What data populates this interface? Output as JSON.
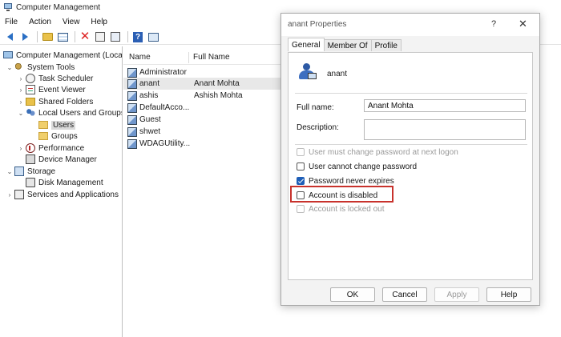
{
  "window": {
    "title": "Computer Management"
  },
  "menu": [
    "File",
    "Action",
    "View",
    "Help"
  ],
  "tree": [
    {
      "label": "Computer Management (Local",
      "caret": "",
      "icon": "computer-icon"
    },
    {
      "label": "System Tools",
      "caret": "v",
      "icon": "tools-icon"
    },
    {
      "label": "Task Scheduler",
      "caret": ">",
      "icon": "clock-icon"
    },
    {
      "label": "Event Viewer",
      "caret": ">",
      "icon": "event-viewer-icon"
    },
    {
      "label": "Shared Folders",
      "caret": ">",
      "icon": "shared-folder-icon"
    },
    {
      "label": "Local Users and Groups",
      "caret": "v",
      "icon": "users-icon"
    },
    {
      "label": "Users",
      "caret": "",
      "icon": "folder-icon",
      "selected": true
    },
    {
      "label": "Groups",
      "caret": "",
      "icon": "folder-icon"
    },
    {
      "label": "Performance",
      "caret": ">",
      "icon": "performance-icon"
    },
    {
      "label": "Device Manager",
      "caret": "",
      "icon": "device-icon"
    },
    {
      "label": "Storage",
      "caret": "v",
      "icon": "storage-icon"
    },
    {
      "label": "Disk Management",
      "caret": "",
      "icon": "disk-icon"
    },
    {
      "label": "Services and Applications",
      "caret": ">",
      "icon": "services-icon"
    }
  ],
  "list": {
    "columns": [
      "Name",
      "Full Name"
    ],
    "rows": [
      {
        "name": "Administrator",
        "full": ""
      },
      {
        "name": "anant",
        "full": "Anant Mohta",
        "selected": true
      },
      {
        "name": "ashis",
        "full": "Ashish Mohta"
      },
      {
        "name": "DefaultAcco...",
        "full": ""
      },
      {
        "name": "Guest",
        "full": ""
      },
      {
        "name": "shwet",
        "full": ""
      },
      {
        "name": "WDAGUtility...",
        "full": ""
      }
    ]
  },
  "dialog": {
    "title": "anant Properties",
    "help_glyph": "?",
    "close_glyph": "✕",
    "tabs": [
      "General",
      "Member Of",
      "Profile"
    ],
    "username": "anant",
    "full_name_label": "Full name:",
    "full_name_value": "Anant Mohta",
    "description_label": "Description:",
    "description_value": "",
    "checkboxes": [
      {
        "label": "User must change password at next logon",
        "checked": false,
        "disabled": true
      },
      {
        "label": "User cannot change password",
        "checked": false,
        "disabled": false
      },
      {
        "label": "Password never expires",
        "checked": true,
        "disabled": false
      },
      {
        "label": "Account is disabled",
        "checked": false,
        "disabled": false
      },
      {
        "label": "Account is locked out",
        "checked": false,
        "disabled": true
      }
    ],
    "buttons": {
      "ok": "OK",
      "cancel": "Cancel",
      "apply": "Apply",
      "help": "Help"
    }
  },
  "colors": {
    "highlight": "#c8322c",
    "accent": "#1f5fb8"
  }
}
